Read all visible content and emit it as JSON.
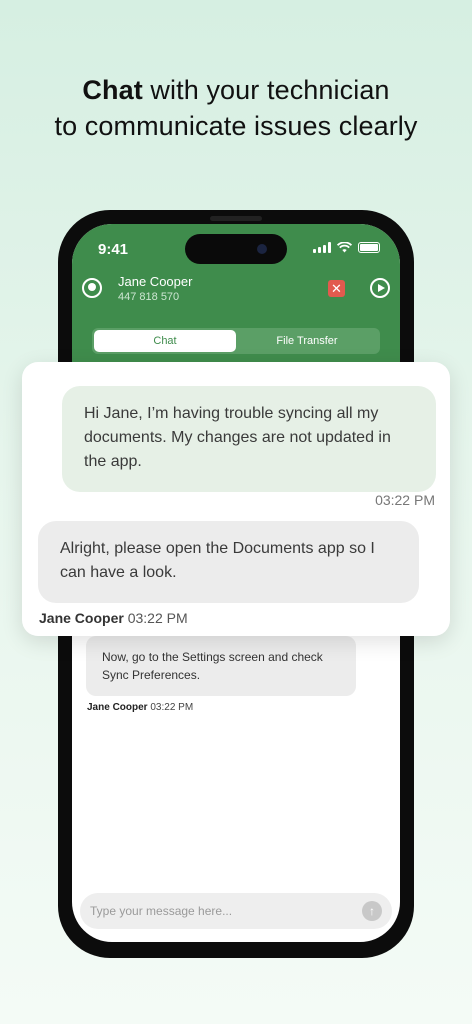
{
  "headline": {
    "bold": "Chat",
    "line1_rest": " with your technician",
    "line2": "to communicate issues clearly"
  },
  "status_bar": {
    "time": "9:41"
  },
  "contact": {
    "name": "Jane Cooper",
    "phone": "447 818 570"
  },
  "header_actions": {
    "end_icon": "✕"
  },
  "tabs": [
    {
      "label": "Chat",
      "active": true
    },
    {
      "label": "File Transfer",
      "active": false
    }
  ],
  "messages": {
    "outgoing": {
      "text": "Hi Jane, I’m having trouble syncing all my documents. My changes are not updated in the app.",
      "time": "03:22 PM"
    },
    "incoming": {
      "text": "Alright, please open the Documents app so I can have a look.",
      "sender": "Jane Cooper",
      "time": "03:22 PM"
    },
    "incoming2": {
      "text": "Now, go to the Settings screen and check Sync Preferences.",
      "sender": "Jane Cooper",
      "time": "03:22 PM"
    }
  },
  "composer": {
    "placeholder": "Type your message here...",
    "send_icon": "↑"
  },
  "colors": {
    "brand_green": "#3f8c4c",
    "outgoing_bubble": "#e6f0e6",
    "incoming_bubble": "#ececec",
    "end_button": "#e25a4e"
  },
  "icons": [
    "contact-icon",
    "end-session-icon",
    "play-icon",
    "signal-icon",
    "wifi-icon",
    "battery-icon",
    "send-icon"
  ]
}
